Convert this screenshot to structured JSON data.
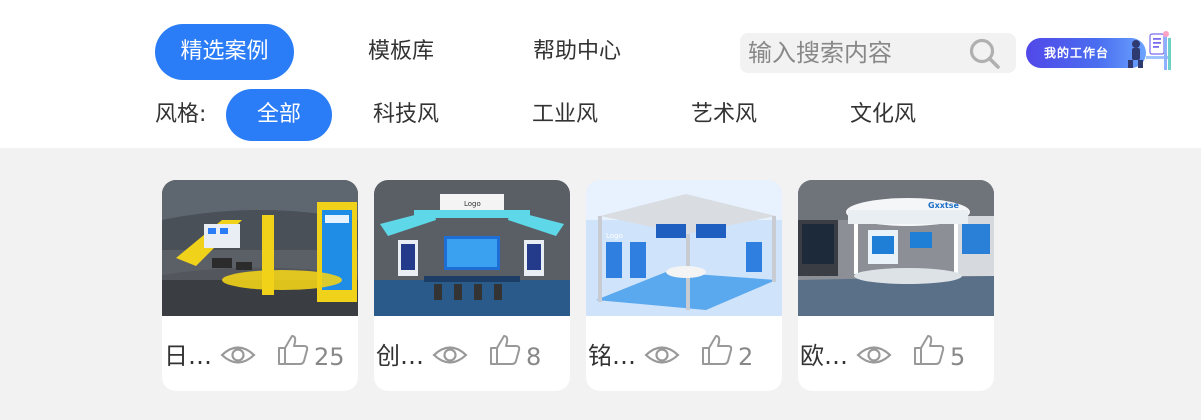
{
  "nav": {
    "tabs": [
      {
        "label": "精选案例",
        "active": true
      },
      {
        "label": "模板库",
        "active": false
      },
      {
        "label": "帮助中心",
        "active": false
      }
    ]
  },
  "search": {
    "placeholder": "输入搜索内容",
    "value": "",
    "icon": "search-icon"
  },
  "workbench": {
    "label": "我的工作台"
  },
  "filter": {
    "label": "风格:",
    "tabs": [
      {
        "label": "全部",
        "active": true
      },
      {
        "label": "科技风",
        "active": false
      },
      {
        "label": "工业风",
        "active": false
      },
      {
        "label": "艺术风",
        "active": false
      },
      {
        "label": "文化风",
        "active": false
      }
    ]
  },
  "cards": [
    {
      "title": "日…",
      "likes": "25"
    },
    {
      "title": "创…",
      "likes": "8"
    },
    {
      "title": "铭…",
      "likes": "2"
    },
    {
      "title": "欧…",
      "likes": "5"
    }
  ],
  "colors": {
    "accent": "#2a7df6",
    "page_bg": "#f2f2f2",
    "muted": "#888888"
  }
}
